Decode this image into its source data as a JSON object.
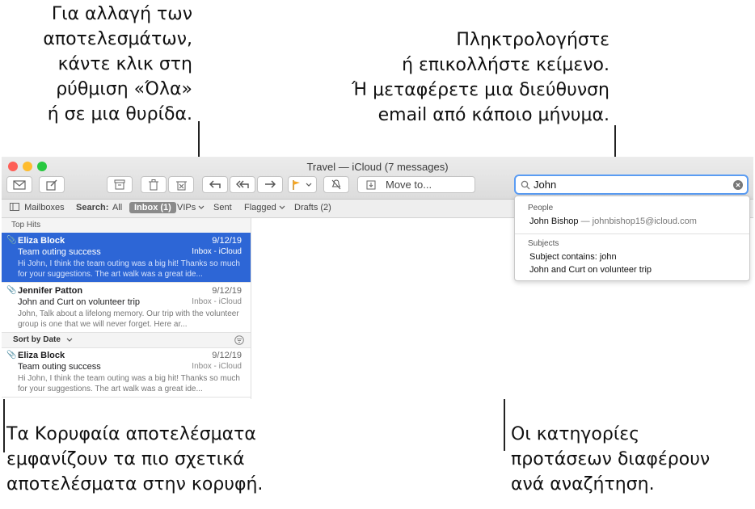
{
  "callouts": {
    "top_left": "Για αλλαγή των\nαποτελεσμάτων,\nκάντε κλικ στη\nρύθμιση «Όλα»\nή σε μια θυρίδα.",
    "top_right": "Πληκτρολογήστε\nή επικολλήστε κείμενο.\nΉ μεταφέρετε μια διεύθυνση\nemail από κάποιο μήνυμα.",
    "bottom_left": "Τα Κορυφαία αποτελέσματα\nεμφανίζουν τα πιο σχετικά\nαποτελέσματα στην κορυφή.",
    "bottom_right": "Οι κατηγορίες\nπροτάσεων διαφέρουν\nανά αναζήτηση."
  },
  "window": {
    "title": "Travel — iCloud (7 messages)",
    "traffic_colors": [
      "#fe5f57",
      "#febc2e",
      "#28c840"
    ]
  },
  "toolbar": {
    "move_to_label": "Move to...",
    "icons": [
      "compose-envelope-icon",
      "new-note-icon",
      "archive-icon",
      "trash-icon",
      "junk-icon",
      "reply-icon",
      "reply-all-icon",
      "forward-icon",
      "flag-icon",
      "chevron-down-icon",
      "mute-bell-icon",
      "move-to-icon"
    ]
  },
  "search": {
    "value": "John",
    "icon": "search-icon",
    "clear_icon": "clear-icon"
  },
  "favorites_bar": {
    "mailboxes": "Mailboxes",
    "search_label": "Search:",
    "all": "All",
    "inbox": "Inbox (1)",
    "vips": "VIPs",
    "sent": "Sent",
    "flagged": "Flagged",
    "drafts": "Drafts (2)"
  },
  "list": {
    "top_hits_label": "Top Hits",
    "sort_label": "Sort by Date",
    "messages": [
      {
        "from": "Eliza Block",
        "date": "9/12/19",
        "subject": "Team outing success",
        "mailbox": "Inbox - iCloud",
        "preview": "Hi John, I think the team outing was a big hit! Thanks so much for your suggestions. The art walk was a great ide...",
        "selected": true
      },
      {
        "from": "Jennifer Patton",
        "date": "9/12/19",
        "subject": "John and Curt on volunteer trip",
        "mailbox": "Inbox - iCloud",
        "preview": "John, Talk about a lifelong memory. Our trip with the volunteer group is one that we will never forget. Here ar...",
        "selected": false
      },
      {
        "from": "Eliza Block",
        "date": "9/12/19",
        "subject": "Team outing success",
        "mailbox": "Inbox - iCloud",
        "preview": "Hi John, I think the team outing was a big hit! Thanks so much for your suggestions. The art walk was a great ide...",
        "selected": false
      }
    ]
  },
  "suggestions": {
    "people_header": "People",
    "person_name": "John Bishop",
    "person_email": "— johnbishop15@icloud.com",
    "subjects_header": "Subjects",
    "subject_items": [
      "Subject contains: john",
      "John and Curt on volunteer trip"
    ]
  }
}
